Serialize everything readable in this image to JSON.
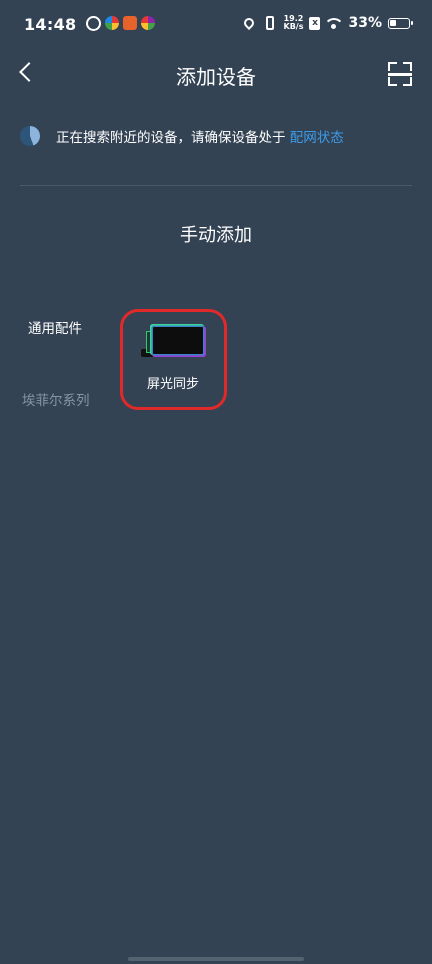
{
  "status_bar": {
    "time": "14:48",
    "net_speed_value": "19.2",
    "net_speed_unit": "KB/s",
    "sim_label": "x",
    "battery": "33%"
  },
  "header": {
    "title": "添加设备",
    "back_icon": "chevron-left-icon",
    "scan_icon": "scan-icon"
  },
  "search_status": {
    "text": "正在搜索附近的设备，请确保设备处于 ",
    "link": "配网状态"
  },
  "manual": {
    "title": "手动添加",
    "categories": [
      {
        "label": "通用配件",
        "active": true
      },
      {
        "label": "埃菲尔系列",
        "active": false
      }
    ],
    "devices": [
      {
        "label": "屏光同步",
        "icon": "monitor-device-icon"
      }
    ]
  },
  "colors": {
    "background": "#344354",
    "link": "#3d9be9",
    "highlight": "#e02a2a",
    "inactive": "#8795a3"
  }
}
